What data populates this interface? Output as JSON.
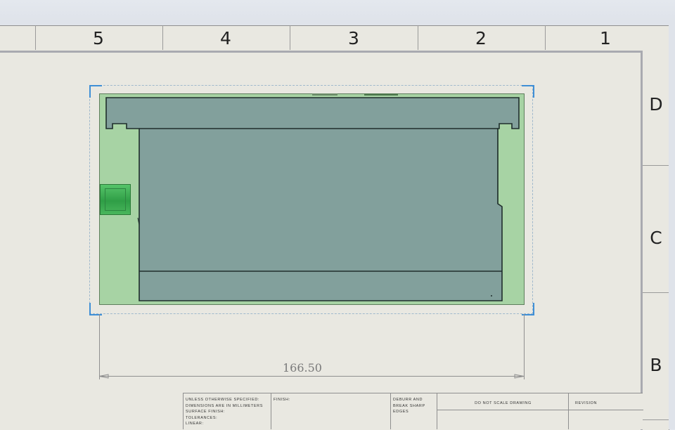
{
  "zones": {
    "columns": [
      "5",
      "4",
      "3",
      "2",
      "1"
    ],
    "rows": [
      "D",
      "C",
      "B"
    ]
  },
  "dimension": {
    "value": "166.50"
  },
  "title_block": {
    "general_notes": "UNLESS OTHERWISE SPECIFIED:\nDIMENSIONS ARE IN MILLIMETERS\nSURFACE FINISH:\nTOLERANCES:\n   LINEAR:",
    "finish_label": "FINISH:",
    "deburr_label": "DEBURR AND\nBREAK SHARP\nEDGES",
    "scale_note": "DO NOT SCALE DRAWING",
    "revision_label": "REVISION"
  },
  "colors": {
    "sheet": "#e9e8e1",
    "pcb": "#a7d3a4",
    "enclosure": "#82a09c",
    "connector": "#3fae53",
    "view_corner": "#3f8fd6"
  }
}
